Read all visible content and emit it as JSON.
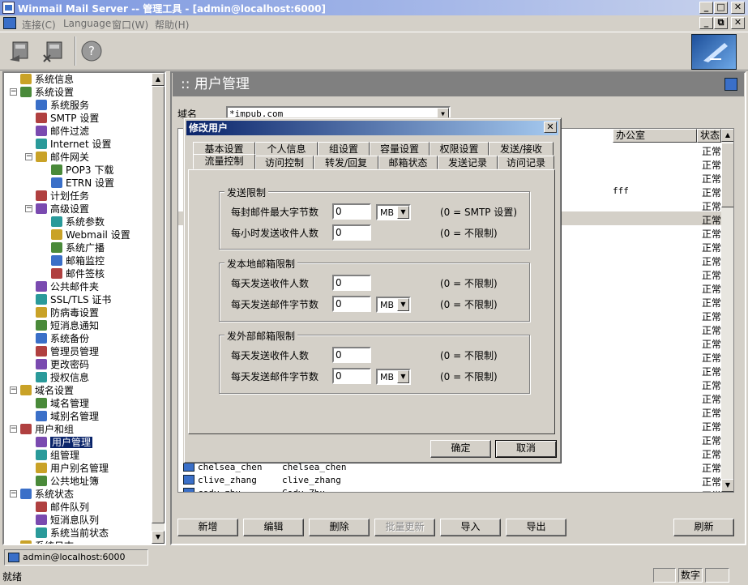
{
  "window": {
    "title": "Winmail Mail Server -- 管理工具 - [admin@localhost:6000]"
  },
  "menu": [
    "连接(C)",
    "Language",
    "窗口(W)",
    "帮助(H)"
  ],
  "tree": [
    {
      "label": "系统信息",
      "depth": 0
    },
    {
      "label": "系统设置",
      "depth": 0
    },
    {
      "label": "系统服务",
      "depth": 1
    },
    {
      "label": "SMTP 设置",
      "depth": 1
    },
    {
      "label": "邮件过滤",
      "depth": 1
    },
    {
      "label": "Internet 设置",
      "depth": 1
    },
    {
      "label": "邮件网关",
      "depth": 1
    },
    {
      "label": "POP3 下载",
      "depth": 2
    },
    {
      "label": "ETRN 设置",
      "depth": 2
    },
    {
      "label": "计划任务",
      "depth": 1
    },
    {
      "label": "高级设置",
      "depth": 1
    },
    {
      "label": "系统参数",
      "depth": 2
    },
    {
      "label": "Webmail 设置",
      "depth": 2
    },
    {
      "label": "系统广播",
      "depth": 2
    },
    {
      "label": "邮箱监控",
      "depth": 2
    },
    {
      "label": "邮件签核",
      "depth": 2
    },
    {
      "label": "公共邮件夹",
      "depth": 1
    },
    {
      "label": "SSL/TLS 证书",
      "depth": 1
    },
    {
      "label": "防病毒设置",
      "depth": 1
    },
    {
      "label": "短消息通知",
      "depth": 1
    },
    {
      "label": "系统备份",
      "depth": 1
    },
    {
      "label": "管理员管理",
      "depth": 1
    },
    {
      "label": "更改密码",
      "depth": 1
    },
    {
      "label": "授权信息",
      "depth": 1
    },
    {
      "label": "域名设置",
      "depth": 0
    },
    {
      "label": "域名管理",
      "depth": 1
    },
    {
      "label": "域别名管理",
      "depth": 1
    },
    {
      "label": "用户和组",
      "depth": 0
    },
    {
      "label": "用户管理",
      "depth": 1,
      "selected": true
    },
    {
      "label": "组管理",
      "depth": 1
    },
    {
      "label": "用户别名管理",
      "depth": 1
    },
    {
      "label": "公共地址簿",
      "depth": 1
    },
    {
      "label": "系统状态",
      "depth": 0
    },
    {
      "label": "邮件队列",
      "depth": 1
    },
    {
      "label": "短消息队列",
      "depth": 1
    },
    {
      "label": "系统当前状态",
      "depth": 1
    },
    {
      "label": "系统日志",
      "depth": 0
    }
  ],
  "panel": {
    "title": ":: 用户管理",
    "domain_label": "域名",
    "domain_value": "*impub.com",
    "columns": {
      "office": "办公室",
      "status": "状态"
    },
    "office_value": "fff",
    "status_values": [
      "正常",
      "正常",
      "正常",
      "正常",
      "正常",
      "正常",
      "正常",
      "正常",
      "正常",
      "正常",
      "正常",
      "正常",
      "正常",
      "正常",
      "正常",
      "正常",
      "正常",
      "正常",
      "正常",
      "正常",
      "正常",
      "正常",
      "正常",
      "正常",
      "正常",
      "正常"
    ],
    "visible_rows": [
      {
        "name": "chelsea_chen",
        "full": "chelsea_chen"
      },
      {
        "name": "clive_zhang",
        "full": "clive_zhang"
      },
      {
        "name": "cody_zhu",
        "full": "Cody Zhu"
      }
    ],
    "buttons": {
      "add": "新增",
      "edit": "编辑",
      "delete": "删除",
      "batch": "批量更新",
      "import": "导入",
      "export": "导出",
      "refresh": "刷新"
    }
  },
  "dialog": {
    "title": "修改用户",
    "tabs_row1": [
      "基本设置",
      "个人信息",
      "组设置",
      "容量设置",
      "权限设置",
      "发送/接收"
    ],
    "tabs_row2": [
      "流量控制",
      "访问控制",
      "转发/回复",
      "邮箱状态",
      "发送记录",
      "访问记录"
    ],
    "groups": [
      {
        "title": "发送限制",
        "fields": [
          {
            "label": "每封邮件最大字节数",
            "value": "0",
            "unit": "MB",
            "note": "(0 = SMTP 设置)"
          },
          {
            "label": "每小时发送收件人数",
            "value": "0",
            "note": "(0 = 不限制)"
          }
        ]
      },
      {
        "title": "发本地邮箱限制",
        "fields": [
          {
            "label": "每天发送收件人数",
            "value": "0",
            "note": "(0 = 不限制)"
          },
          {
            "label": "每天发送邮件字节数",
            "value": "0",
            "unit": "MB",
            "note": "(0 = 不限制)"
          }
        ]
      },
      {
        "title": "发外部邮箱限制",
        "fields": [
          {
            "label": "每天发送收件人数",
            "value": "0",
            "note": "(0 = 不限制)"
          },
          {
            "label": "每天发送邮件字节数",
            "value": "0",
            "unit": "MB",
            "note": "(0 = 不限制)"
          }
        ]
      }
    ],
    "ok": "确定",
    "cancel": "取消"
  },
  "connection": "admin@localhost:6000",
  "status": {
    "left": "就绪",
    "numlock": "数字"
  }
}
